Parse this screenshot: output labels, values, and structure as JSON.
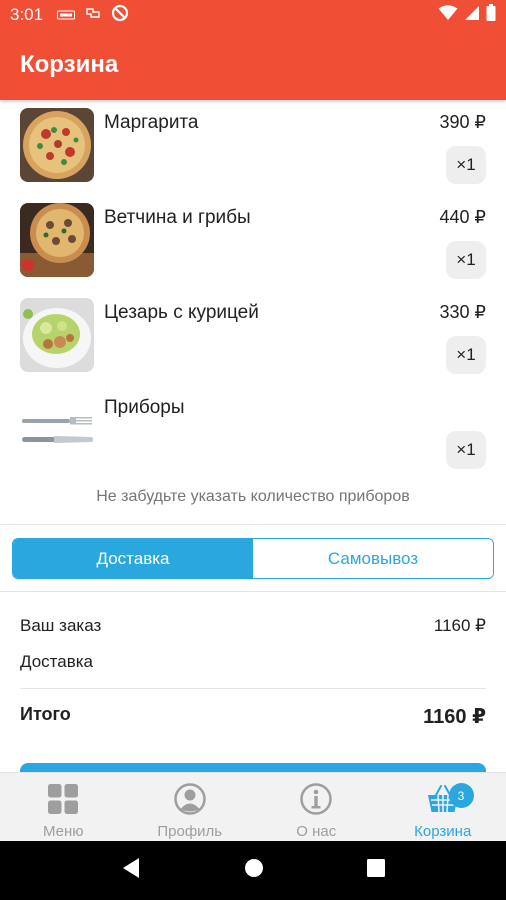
{
  "status_bar": {
    "time": "3:01",
    "icons": [
      "sim-icon",
      "carrier-icon",
      "do-not-disturb-icon",
      "wifi-icon",
      "signal-icon",
      "battery-icon"
    ]
  },
  "app_bar": {
    "title": "Корзина"
  },
  "cart": {
    "items": [
      {
        "name": "Маргарита",
        "price": "390 ₽",
        "quantity": "×1",
        "image": "pizza-margherita-image"
      },
      {
        "name": "Ветчина и грибы",
        "price": "440 ₽",
        "quantity": "×1",
        "image": "pizza-ham-mushroom-image"
      },
      {
        "name": "Цезарь с курицей",
        "price": "330 ₽",
        "quantity": "×1",
        "image": "caesar-salad-image"
      },
      {
        "name": "Приборы",
        "price": "",
        "quantity": "×1",
        "image": "cutlery-image"
      }
    ],
    "hint": "Не забудьте указать количество приборов"
  },
  "delivery_toggle": {
    "options": [
      "Доставка",
      "Самовывоз"
    ],
    "selected": "Доставка"
  },
  "summary": {
    "order_label": "Ваш заказ",
    "order_value": "1160 ₽",
    "delivery_label": "Доставка",
    "delivery_value": "",
    "total_label": "Итого",
    "total_value": "1160 ₽"
  },
  "bottom_nav": {
    "items": [
      {
        "label": "Меню",
        "icon": "grid-icon",
        "active": false
      },
      {
        "label": "Профиль",
        "icon": "profile-icon",
        "active": false
      },
      {
        "label": "О нас",
        "icon": "info-icon",
        "active": false
      },
      {
        "label": "Корзина",
        "icon": "basket-icon",
        "active": true
      }
    ],
    "cart_badge": "3"
  },
  "colors": {
    "primary": "#f04f36",
    "accent": "#2ba7e0",
    "nav_background": "#f2f2f2",
    "inactive": "#9e9e9e"
  }
}
